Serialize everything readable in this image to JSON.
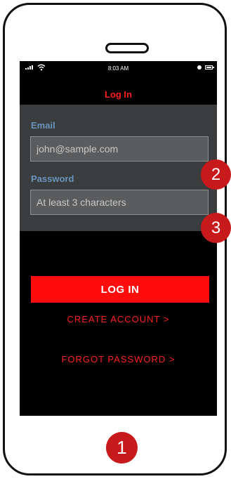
{
  "status_bar": {
    "time": "8:03 AM"
  },
  "screen": {
    "title": "Log In"
  },
  "form": {
    "email_label": "Email",
    "email_value": "john@sample.com",
    "password_label": "Password",
    "password_placeholder": "At least 3 characters"
  },
  "actions": {
    "login_label": "LOG IN",
    "create_account_label": "CREATE ACCOUNT >",
    "forgot_password_label": "FORGOT PASSWORD >"
  },
  "annotations": {
    "home_badge": "1",
    "form_badge": "2",
    "button_badge": "3"
  },
  "colors": {
    "accent": "#ff1f1f",
    "panel": "#3a3c3e",
    "badge": "#c81a1a",
    "label": "#6a95bf"
  }
}
